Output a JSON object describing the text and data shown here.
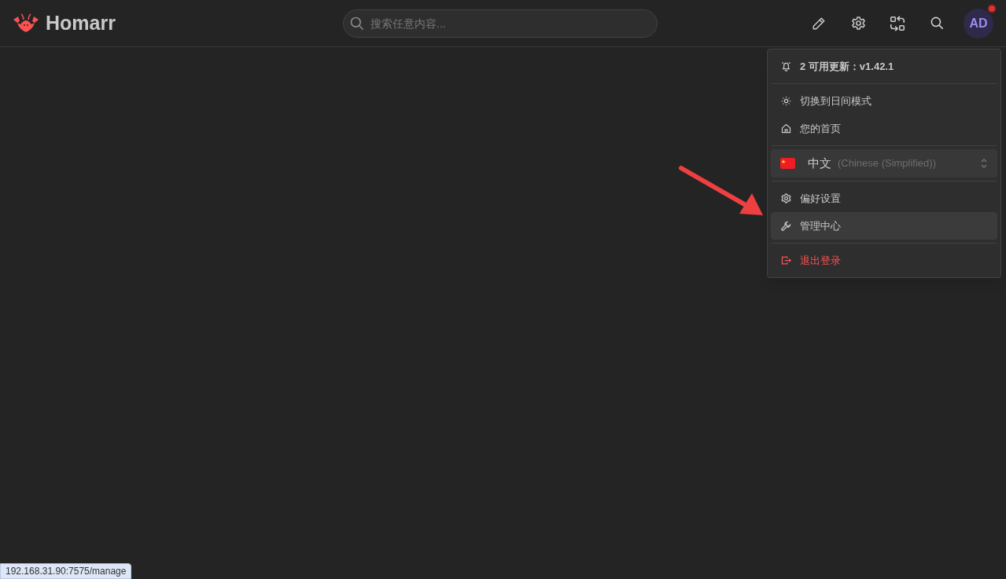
{
  "header": {
    "brand": "Homarr",
    "search": {
      "placeholder": "搜索任意内容..."
    },
    "avatar": {
      "initials": "AD",
      "has_notification": true
    }
  },
  "user_menu": {
    "sections": [
      [
        {
          "kind": "notice",
          "label": "2 可用更新：v1.42.1",
          "selected": false
        }
      ],
      [
        {
          "kind": "item",
          "label": "切换到日间模式",
          "selected": false
        },
        {
          "kind": "item",
          "label": "您的首页",
          "selected": false
        }
      ],
      [
        {
          "kind": "language",
          "label": "中文",
          "detail": "(Chinese (Simplified))"
        }
      ],
      [
        {
          "kind": "item",
          "label": "偏好设置",
          "selected": false
        },
        {
          "kind": "item",
          "label": "管理中心",
          "selected": true
        }
      ],
      [
        {
          "kind": "danger",
          "label": "退出登录",
          "selected": false
        }
      ]
    ]
  },
  "status_url": "192.168.31.90:7575/manage"
}
